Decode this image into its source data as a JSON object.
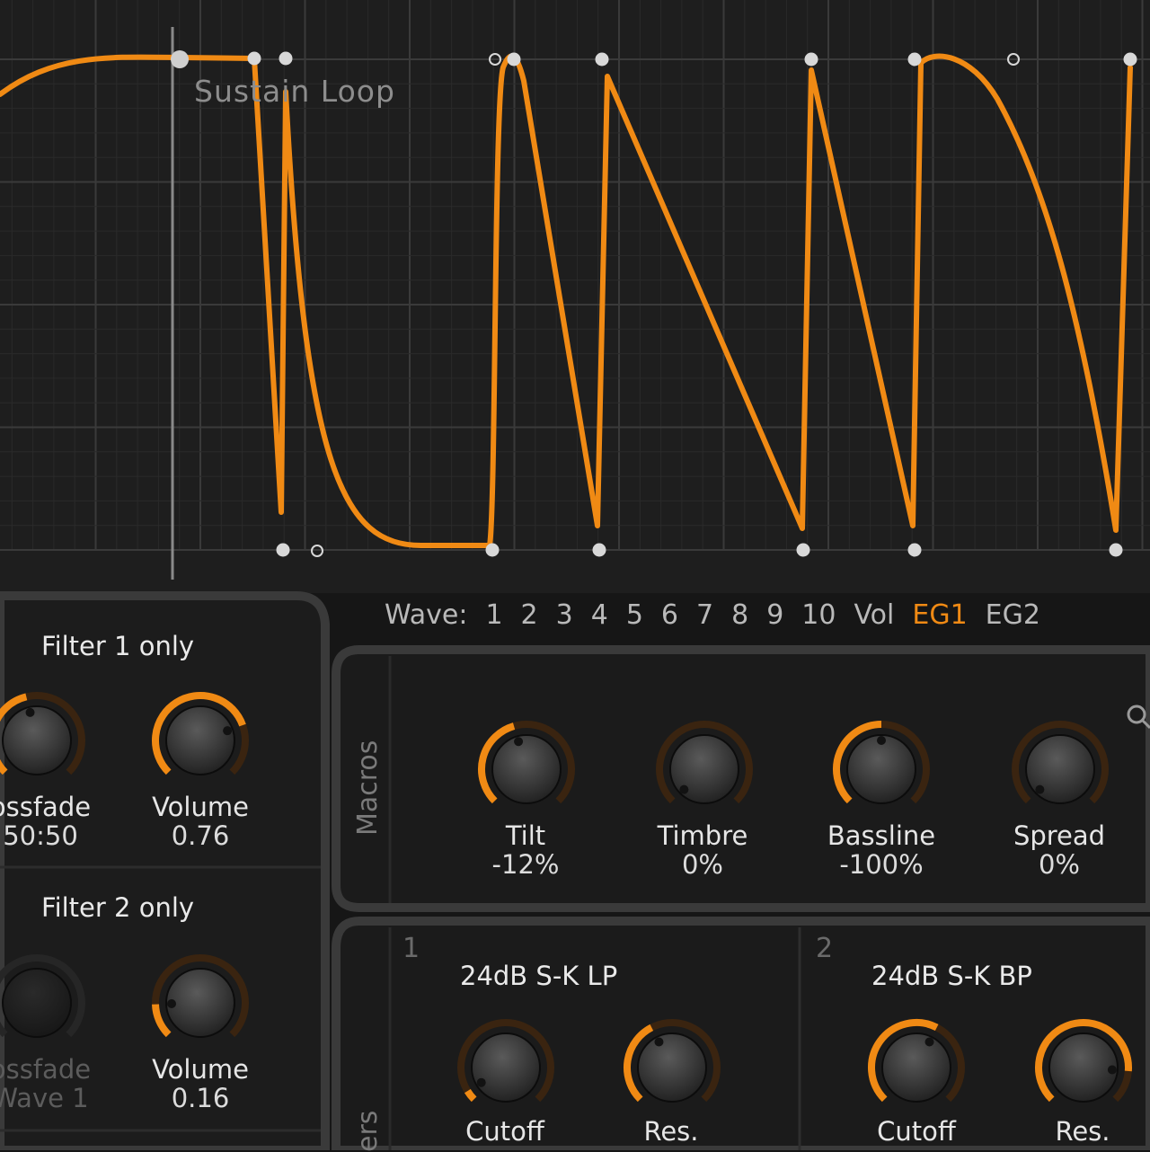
{
  "envelope": {
    "sustain_label": "Sustain Loop"
  },
  "tabs": {
    "prefix": "Wave:",
    "items": [
      "1",
      "2",
      "3",
      "4",
      "5",
      "6",
      "7",
      "8",
      "9",
      "10",
      "Vol",
      "EG1",
      "EG2"
    ],
    "active": "EG1"
  },
  "left_panel": {
    "filter1_title": "Filter 1 only",
    "filter2_title": "Filter 2 only",
    "knobs": [
      {
        "name": "ossfade",
        "value": "50:50",
        "level": 0.45
      },
      {
        "name": "Volume",
        "value": "0.76",
        "level": 0.76
      },
      {
        "name": "ossfade",
        "value": "Wave 1",
        "level": 0
      },
      {
        "name": "Volume",
        "value": "0.16",
        "level": 0.16
      }
    ]
  },
  "macros": {
    "title": "Macros",
    "knobs": [
      {
        "name": "Tilt",
        "value": "-12%",
        "level": 0.44
      },
      {
        "name": "Timbre",
        "value": "0%",
        "level": 0
      },
      {
        "name": "Bassline",
        "value": "-100%",
        "level": 0.5
      },
      {
        "name": "Spread",
        "value": "0%",
        "level": 0
      }
    ]
  },
  "filters": {
    "title": "ers",
    "units": [
      {
        "number": "1",
        "type": "24dB S-K LP",
        "knobs": [
          {
            "name": "Cutoff",
            "level": 0.05
          },
          {
            "name": "Res.",
            "level": 0.4
          }
        ]
      },
      {
        "number": "2",
        "type": "24dB S-K BP",
        "knobs": [
          {
            "name": "Cutoff",
            "level": 0.6
          },
          {
            "name": "Res.",
            "level": 0.85
          }
        ]
      }
    ]
  },
  "colors": {
    "accent": "#f08a14",
    "background": "#161616",
    "grid": "#2e2e2e"
  }
}
